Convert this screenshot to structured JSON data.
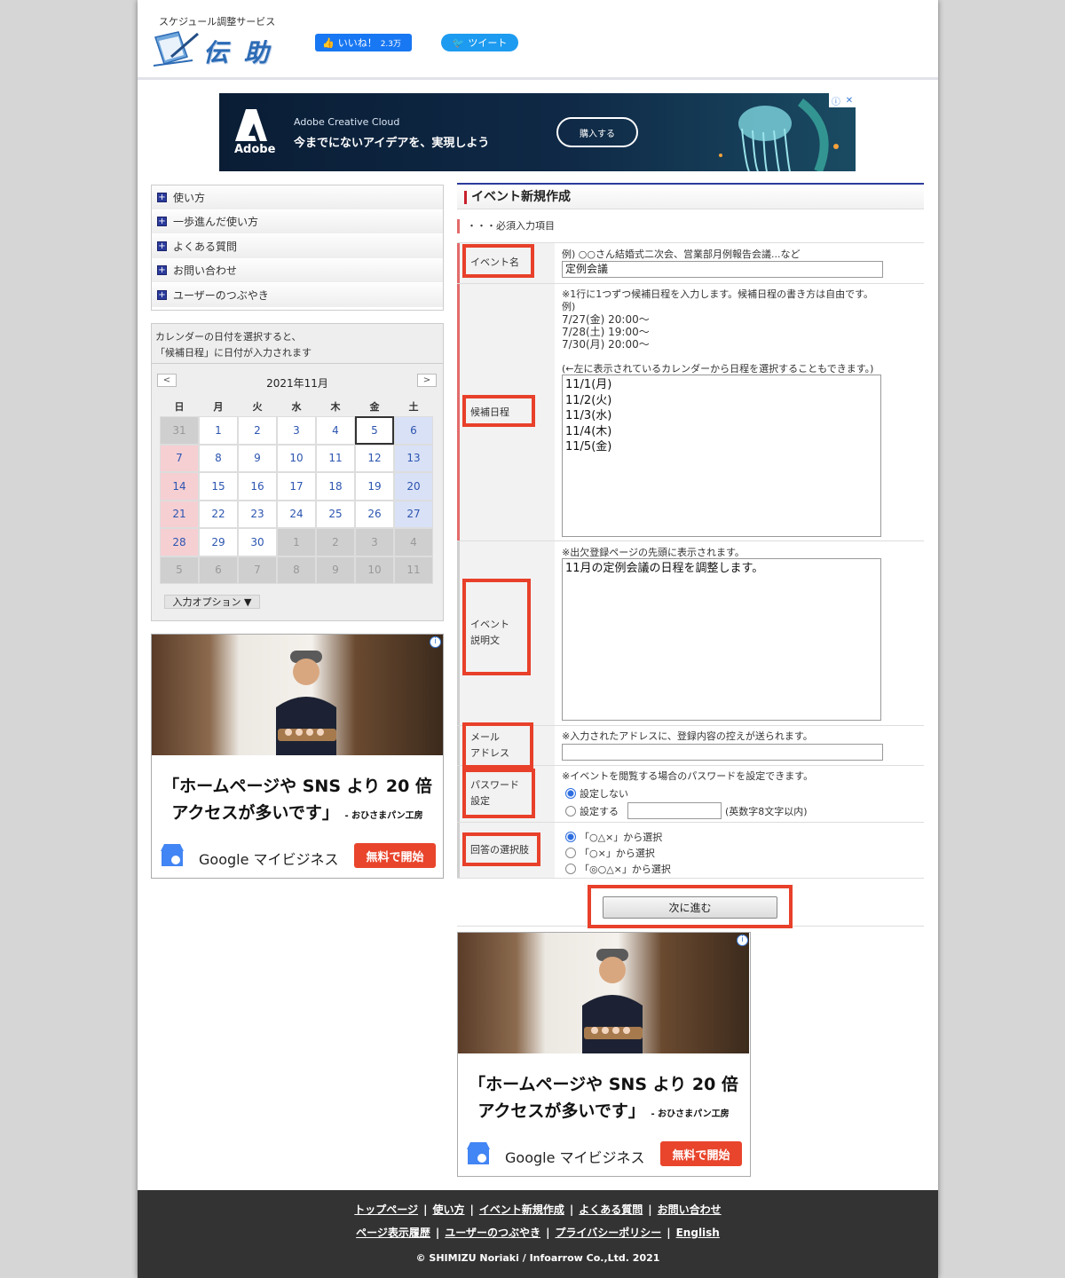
{
  "header": {
    "tagline": "スケジュール調整サービス",
    "logo_text": "伝 助",
    "like_label": "いいね！",
    "like_count": "2.3万",
    "tweet_label": "ツイート"
  },
  "top_ad": {
    "brand": "Adobe",
    "subtitle": "Adobe Creative Cloud",
    "headline": "今までにないアイデアを、実現しよう",
    "cta": "購入する"
  },
  "nav": {
    "items": [
      {
        "label": "使い方"
      },
      {
        "label": "一歩進んだ使い方"
      },
      {
        "label": "よくある質問"
      },
      {
        "label": "お問い合わせ"
      },
      {
        "label": "ユーザーのつぶやき"
      }
    ]
  },
  "calendar": {
    "note_line1": "カレンダーの日付を選択すると、",
    "note_line2": "「候補日程」に日付が入力されます",
    "title": "2021年11月",
    "prev": "<",
    "next": ">",
    "weekdays": [
      "日",
      "月",
      "火",
      "水",
      "木",
      "金",
      "土"
    ],
    "days": [
      "31",
      "1",
      "2",
      "3",
      "4",
      "5",
      "6",
      "7",
      "8",
      "9",
      "10",
      "11",
      "12",
      "13",
      "14",
      "15",
      "16",
      "17",
      "18",
      "19",
      "20",
      "21",
      "22",
      "23",
      "24",
      "25",
      "26",
      "27",
      "28",
      "29",
      "30",
      "1",
      "2",
      "3",
      "4",
      "5",
      "6",
      "7",
      "8",
      "9",
      "10",
      "11"
    ],
    "option_label": "入力オプション ▼"
  },
  "side_ad": {
    "headline1": "「ホームページや SNS より 20 倍",
    "headline2": "アクセスが多いです」",
    "attribution": "- おひさまパン工房",
    "product": "Google マイビジネス",
    "cta": "無料で開始"
  },
  "form": {
    "title": "イベント新規作成",
    "required_note": "・・・必須入力項目",
    "event_name": {
      "label": "イベント名",
      "hint": "例) ○○さん結婚式二次会、営業部月例報告会議...など",
      "value": "定例会議"
    },
    "dates": {
      "label": "候補日程",
      "hint": "※1行に1つずつ候補日程を入力します。候補日程の書き方は自由です。",
      "example_line1": "例)",
      "example_line2": "7/27(金) 20:00〜",
      "example_line3": "7/28(土) 19:00〜",
      "example_line4": "7/30(月) 20:00〜",
      "calendar_hint": "(←左に表示されているカレンダーから日程を選択することもできます。)",
      "value": "11/1(月)\n11/2(火)\n11/3(水)\n11/4(木)\n11/5(金)"
    },
    "description": {
      "label_line1": "イベント",
      "label_line2": "説明文",
      "hint": "※出欠登録ページの先頭に表示されます。",
      "value": "11月の定例会議の日程を調整します。"
    },
    "email": {
      "label_line1": "メール",
      "label_line2": "アドレス",
      "hint": "※入力されたアドレスに、登録内容の控えが送られます。",
      "value": ""
    },
    "password": {
      "label_line1": "パスワード",
      "label_line2": "設定",
      "hint": "※イベントを閲覧する場合のパスワードを設定できます。",
      "opt_none": "設定しない",
      "opt_set": "設定する",
      "note": "(英数字8文字以内)"
    },
    "choices": {
      "label": "回答の選択肢",
      "opt1": "「○△×」から選択",
      "opt2": "「○×」から選択",
      "opt3": "「◎○△×」から選択"
    },
    "next_button": "次に進む"
  },
  "footer": {
    "links_row1": [
      "トップページ",
      "使い方",
      "イベント新規作成",
      "よくある質問",
      "お問い合わせ"
    ],
    "links_row2": [
      "ページ表示履歴",
      "ユーザーのつぶやき",
      "プライバシーポリシー",
      "English"
    ],
    "copyright": "© SHIMIZU Noriaki / Infoarrow Co.,Ltd. 2021"
  },
  "colors": {
    "brand_blue": "#2c6bb5",
    "nav_accent": "#2b3b9c",
    "required_marker": "#e36b6b",
    "annotation_red": "#e8402a",
    "footer_bg": "#333333"
  }
}
